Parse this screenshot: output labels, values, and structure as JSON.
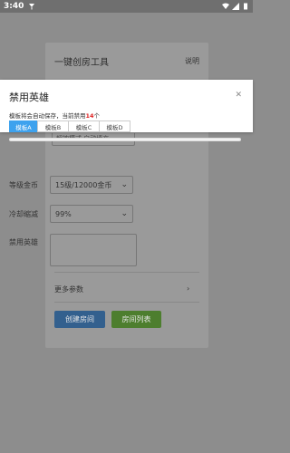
{
  "status_bar": {
    "time": "3:40"
  },
  "card": {
    "title": "一键创房工具",
    "help": "说明",
    "partial_field_text": "超神模式 自动填充",
    "level_gold": {
      "label": "等级金币",
      "value": "15级/12000金币"
    },
    "cooldown": {
      "label": "冷却缩减",
      "value": "99%"
    },
    "banned_heroes": {
      "label": "禁用英雄"
    },
    "more_params": "更多参数",
    "create_room": "创建房间",
    "room_list": "房间列表"
  },
  "modal": {
    "title": "禁用英雄",
    "desc_prefix": "模板将会自动保存，当前禁用",
    "banned_count": "14",
    "desc_suffix": "个",
    "tabs": [
      {
        "label": "模板A"
      },
      {
        "label": "模板B"
      },
      {
        "label": "模板C"
      },
      {
        "label": "模板D"
      }
    ],
    "active_tab": 0
  },
  "colors": {
    "accent_blue": "#3ea2ee",
    "highlight_red": "#e02020",
    "create_btn": "#33608e",
    "list_btn": "#4d7e2e"
  }
}
